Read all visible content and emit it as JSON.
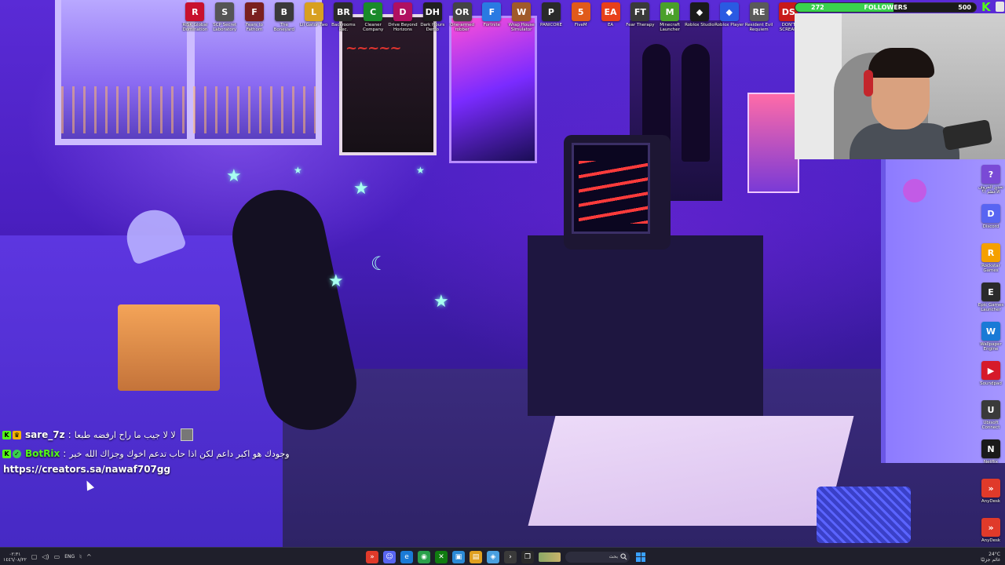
{
  "top_shortcuts": [
    {
      "label": "RISK Global Domination",
      "glyph": "R",
      "color": "#c8102e"
    },
    {
      "label": "SCP Secret Laboratory",
      "glyph": "S",
      "color": "#555555"
    },
    {
      "label": "Fears to Fathom",
      "glyph": "F",
      "color": "#7a1f1f"
    },
    {
      "label": "The Boneyard",
      "glyph": "B",
      "color": "#3a3a3a"
    },
    {
      "label": "Lil Gator Two",
      "glyph": "L",
      "color": "#d8a020"
    },
    {
      "label": "Backrooms Rec.",
      "glyph": "BR",
      "color": "#2b2b2b"
    },
    {
      "label": "Cleaner Company",
      "glyph": "C",
      "color": "#1a8a2a"
    },
    {
      "label": "Drive Beyond Horizons",
      "glyph": "D",
      "color": "#b01060"
    },
    {
      "label": "Dark Hours Demo",
      "glyph": "DH",
      "color": "#202020"
    },
    {
      "label": "One-armed robber",
      "glyph": "OR",
      "color": "#444444"
    },
    {
      "label": "Fortnite",
      "glyph": "F",
      "color": "#2a7ae2"
    },
    {
      "label": "Wrap House Simulator",
      "glyph": "W",
      "color": "#a05a2a"
    },
    {
      "label": "PANICORE",
      "glyph": "P",
      "color": "#2a2a2a"
    },
    {
      "label": "FiveM",
      "glyph": "5",
      "color": "#e05a1a"
    },
    {
      "label": "EA",
      "glyph": "EA",
      "color": "#e8401a"
    },
    {
      "label": "Fear Therapy",
      "glyph": "FT",
      "color": "#3a3a3a"
    },
    {
      "label": "Minecraft Launcher",
      "glyph": "M",
      "color": "#4aa02a"
    },
    {
      "label": "Roblox Studio",
      "glyph": "◆",
      "color": "#1a1a1a"
    },
    {
      "label": "Roblox Player",
      "glyph": "◆",
      "color": "#2a5ae2"
    },
    {
      "label": "Resident Evil Requiem",
      "glyph": "RE",
      "color": "#5a5a5a"
    },
    {
      "label": "DON'T SCREAM",
      "glyph": "DS",
      "color": "#c81a1a"
    }
  ],
  "right_shortcuts": [
    {
      "label": "تحدي الحروف الأعظم !؟",
      "glyph": "?",
      "color": "#7a4ad6"
    },
    {
      "label": "Discord",
      "glyph": "D",
      "color": "#5865f2"
    },
    {
      "label": "Rockstar Games",
      "glyph": "R",
      "color": "#f5a000"
    },
    {
      "label": "Epic Games Launcher",
      "glyph": "E",
      "color": "#2a2a2a"
    },
    {
      "label": "Wallpaper Engine",
      "glyph": "W",
      "color": "#1a7ad6"
    },
    {
      "label": "Soundpad",
      "glyph": "▶",
      "color": "#d61a2a"
    },
    {
      "label": "Ubisoft Connect",
      "glyph": "U",
      "color": "#3a3a3a"
    },
    {
      "label": "Netflix",
      "glyph": "N",
      "color": "#1a1a1a"
    },
    {
      "label": "AnyDesk",
      "glyph": "»",
      "color": "#e03a2a"
    },
    {
      "label": "AnyDesk",
      "glyph": "»",
      "color": "#e03a2a"
    }
  ],
  "followers": {
    "current": "272",
    "label": "FOLLOWERS",
    "goal": "500",
    "progress": 0.544,
    "fill_color": "#3ad14f"
  },
  "brand": {
    "logo_letter": "K",
    "color": "#53fc18"
  },
  "chat": {
    "messages": [
      {
        "user": "sare_7z",
        "user_color": "#ffffff",
        "sep": ":",
        "text": "لا لا جيب ما راح ارفضه طبعا"
      },
      {
        "user": "BotRix",
        "user_color": "#53fc18",
        "sep": ":",
        "text": "وجودك هو اكبر داعم لكن اذا حاب تدعم اخوك وجزاك الله خير"
      }
    ],
    "link": "https://creators.sa/nawaf707gg"
  },
  "taskbar": {
    "date_left": "١٤٤٦/٠٨/٢٢",
    "time_left": "٠٢:٣١",
    "lang": "ENG",
    "search_placeholder": "بحث",
    "weather_temp": "24°C",
    "weather_desc": "غائم جزئيًا"
  }
}
